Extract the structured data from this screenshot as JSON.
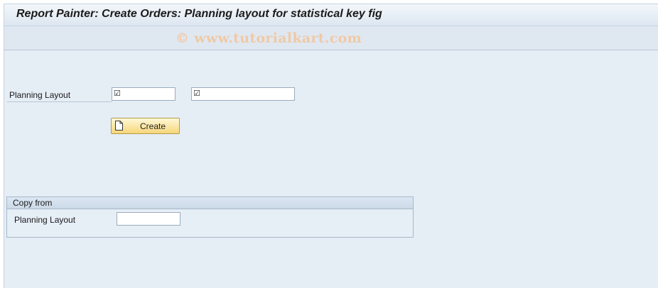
{
  "window": {
    "title": "Report Painter: Create Orders: Planning layout for statistical key fig"
  },
  "toolbar": {
    "watermark": "© www.tutorialkart.com"
  },
  "form": {
    "planning_layout_label": "Planning Layout",
    "field1": {
      "value": "",
      "required_mark": "☑"
    },
    "field2": {
      "value": "",
      "required_mark": "☑"
    },
    "create_button_label": "Create"
  },
  "copy_from": {
    "title": "Copy from",
    "planning_layout_label": "Planning Layout",
    "field": {
      "value": ""
    }
  }
}
